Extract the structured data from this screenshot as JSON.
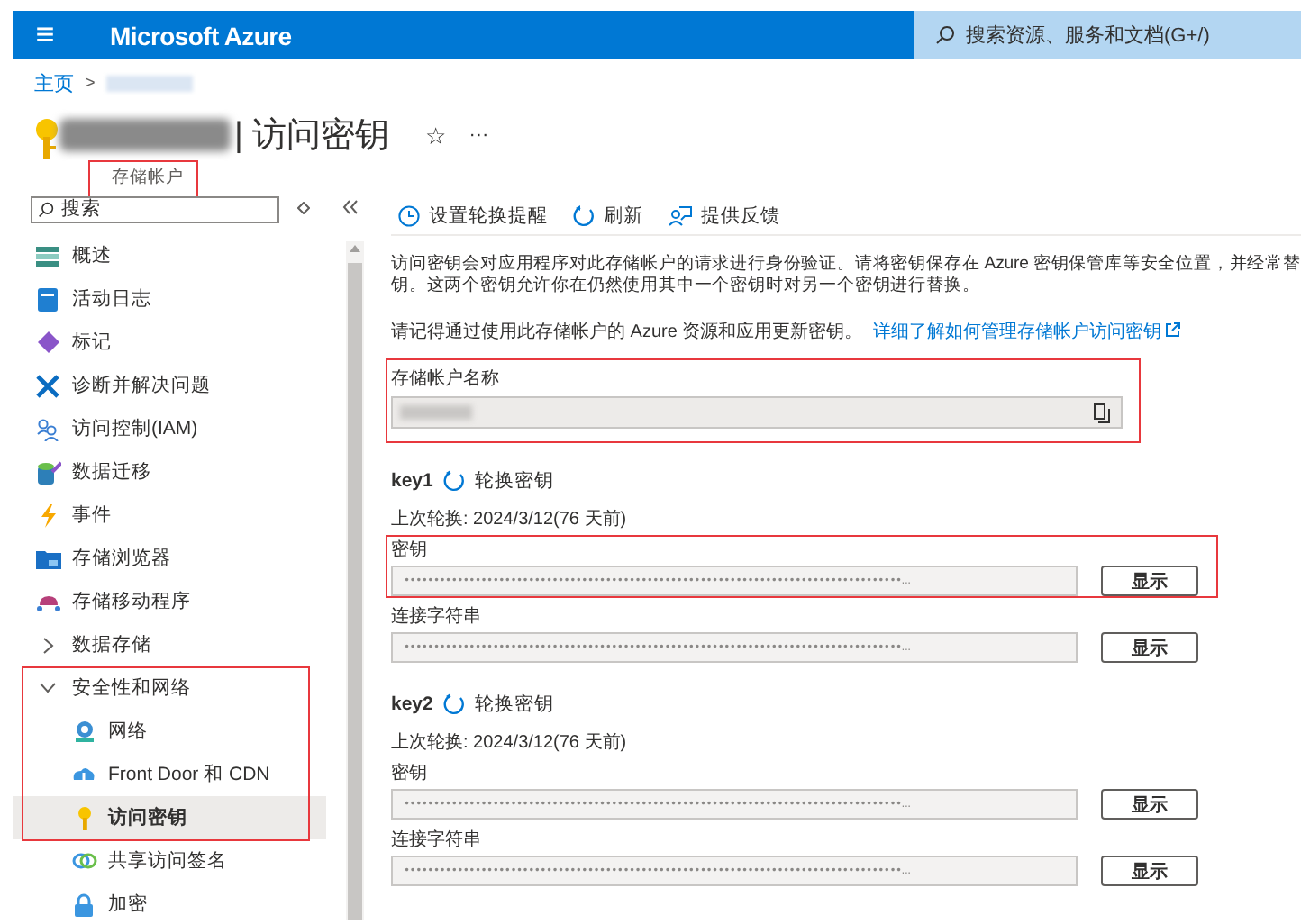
{
  "topbar": {
    "menu": "≡",
    "brand": "Microsoft Azure",
    "search": {
      "placeholder": "搜索资源、服务和文档(G+/)"
    }
  },
  "breadcrumb": {
    "home": "主页",
    "separator": ">"
  },
  "header": {
    "title": "| 访问密钥",
    "subtitle": "存储帐户",
    "subtitle_highlighted": true,
    "favorite": "☆",
    "more": "···"
  },
  "sidebar": {
    "search": {
      "placeholder": "搜索"
    },
    "items": [
      {
        "label": "概述",
        "selected": false
      },
      {
        "label": "活动日志",
        "selected": false
      },
      {
        "label": "标记",
        "selected": false
      },
      {
        "label": "诊断并解决问题",
        "selected": false
      },
      {
        "label": "访问控制(IAM)",
        "selected": false
      },
      {
        "label": "数据迁移",
        "selected": false
      },
      {
        "label": "事件",
        "selected": false
      },
      {
        "label": "存储浏览器",
        "selected": false
      },
      {
        "label": "存储移动程序",
        "selected": false
      },
      {
        "label": "数据存储",
        "kind": "group",
        "expanded": false,
        "highlighted": false
      },
      {
        "label": "安全性和网络",
        "kind": "group",
        "expanded": true,
        "highlighted": true,
        "children": [
          {
            "label": "网络",
            "selected": false
          },
          {
            "label": "Front Door 和 CDN",
            "selected": false
          },
          {
            "label": "访问密钥",
            "selected": true
          },
          {
            "label": "共享访问签名",
            "selected": false
          },
          {
            "label": "加密",
            "selected": false
          }
        ]
      }
    ]
  },
  "toolbar": [
    "设置轮换提醒",
    "刷新",
    "提供反馈"
  ],
  "description": [
    "访问密钥会对应用程序对此存储帐户的请求进行身份验证。请将密钥保存在 Azure 密钥保管库等安全位置，并经常替",
    "钥。这两个密钥允许你在仍然使用其中一个密钥时对另一个密钥进行替换。"
  ],
  "reminder": {
    "text": "请记得通过使用此存储帐户的 Azure 资源和应用更新密钥。",
    "link": "详细了解如何管理存储帐户访问密钥"
  },
  "account_name": {
    "label": "存储帐户名称",
    "highlighted": true
  },
  "keys": [
    {
      "name": "key1",
      "rotate": "轮换密钥",
      "last_rotated": "上次轮换: 2024/3/12(76 天前)",
      "fields": [
        {
          "label": "密钥",
          "value": "••••••••••••••••••••••••••••••••••••••••••••••••••••••••••••••••••••••••••••••••••••...",
          "button": "显示",
          "highlighted": true
        },
        {
          "label": "连接字符串",
          "value": "••••••••••••••••••••••••••••••••••••••••••••••••••••••••••••••••••••••••••••••••••••...",
          "button": "显示",
          "highlighted": false
        }
      ]
    },
    {
      "name": "key2",
      "rotate": "轮换密钥",
      "last_rotated": "上次轮换: 2024/3/12(76 天前)",
      "fields": [
        {
          "label": "密钥",
          "value": "••••••••••••••••••••••••••••••••••••••••••••••••••••••••••••••••••••••••••••••••••••...",
          "button": "显示",
          "highlighted": false
        },
        {
          "label": "连接字符串",
          "value": "••••••••••••••••••••••••••••••••••••••••••••••••••••••••••••••••••••••••••••••••••••...",
          "button": "显示",
          "highlighted": false
        }
      ]
    }
  ]
}
